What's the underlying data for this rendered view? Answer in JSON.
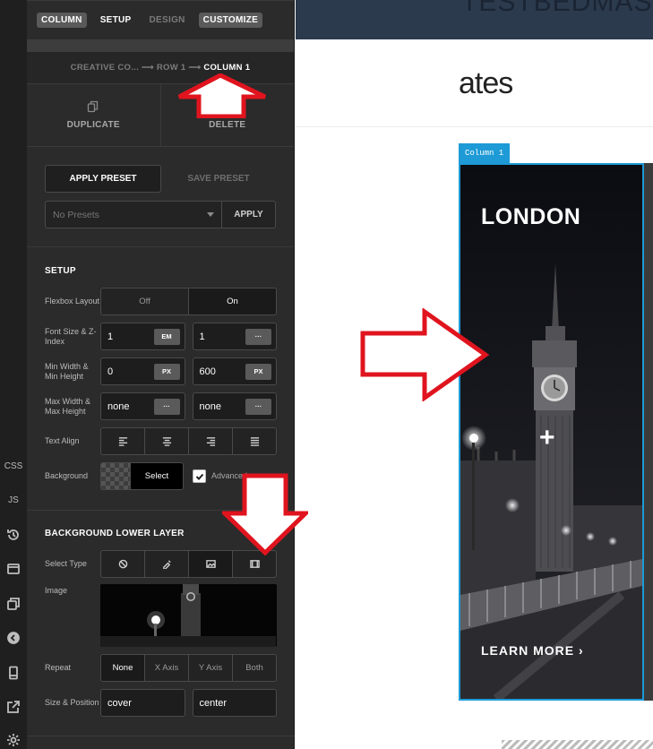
{
  "rail": {
    "items": [
      {
        "name": "css",
        "label": "CSS"
      },
      {
        "name": "js",
        "label": "JS"
      },
      {
        "name": "history-icon"
      },
      {
        "name": "layout-icon"
      },
      {
        "name": "copy-icon"
      },
      {
        "name": "back-icon"
      },
      {
        "name": "mobile-icon"
      },
      {
        "name": "external-link-icon"
      },
      {
        "name": "gear-icon"
      }
    ]
  },
  "panel": {
    "tabs": [
      "COLUMN",
      "SETUP",
      "DESIGN",
      "CUSTOMIZE"
    ],
    "breadcrumb": {
      "part1": "CREATIVE CO...",
      "sep": "⟶",
      "part2": "ROW 1",
      "current": "COLUMN 1"
    },
    "duplicate_label": "DUPLICATE",
    "delete_label": "DELETE",
    "presets": {
      "apply_preset": "APPLY PRESET",
      "save_preset": "SAVE PRESET",
      "select_value": "No Presets",
      "apply": "APPLY"
    },
    "setup": {
      "title": "SETUP",
      "flexbox": {
        "label": "Flexbox Layout",
        "off": "Off",
        "on": "On"
      },
      "font_size": {
        "label": "Font Size & Z-Index",
        "value1": "1",
        "unit1": "EM",
        "value2": "1",
        "unit2": "···"
      },
      "min": {
        "label": "Min Width & Min Height",
        "value1": "0",
        "unit1": "PX",
        "value2": "600",
        "unit2": "PX"
      },
      "max": {
        "label": "Max Width & Max Height",
        "value1": "none",
        "unit1": "···",
        "value2": "none",
        "unit2": "···"
      },
      "text_align": {
        "label": "Text Align"
      },
      "background": {
        "label": "Background",
        "select": "Select",
        "advanced": "Advanced"
      }
    },
    "lower_layer": {
      "title": "BACKGROUND LOWER LAYER",
      "select_type": {
        "label": "Select Type"
      },
      "image": {
        "label": "Image"
      },
      "repeat": {
        "label": "Repeat",
        "options": [
          "None",
          "X Axis",
          "Y Axis",
          "Both"
        ]
      },
      "size_position": {
        "label": "Size & Position",
        "size": "cover",
        "position": "center"
      }
    }
  },
  "canvas": {
    "topbar_text": "TESTBEDMAS",
    "heading": "ates",
    "column_tag": "Column 1",
    "column_title": "LONDON",
    "plus": "+",
    "learn_more": "LEARN MORE  ›"
  },
  "colors": {
    "accent": "#1e9ad6",
    "arrow": "#e0141e",
    "panel": "#2b2b2b"
  }
}
